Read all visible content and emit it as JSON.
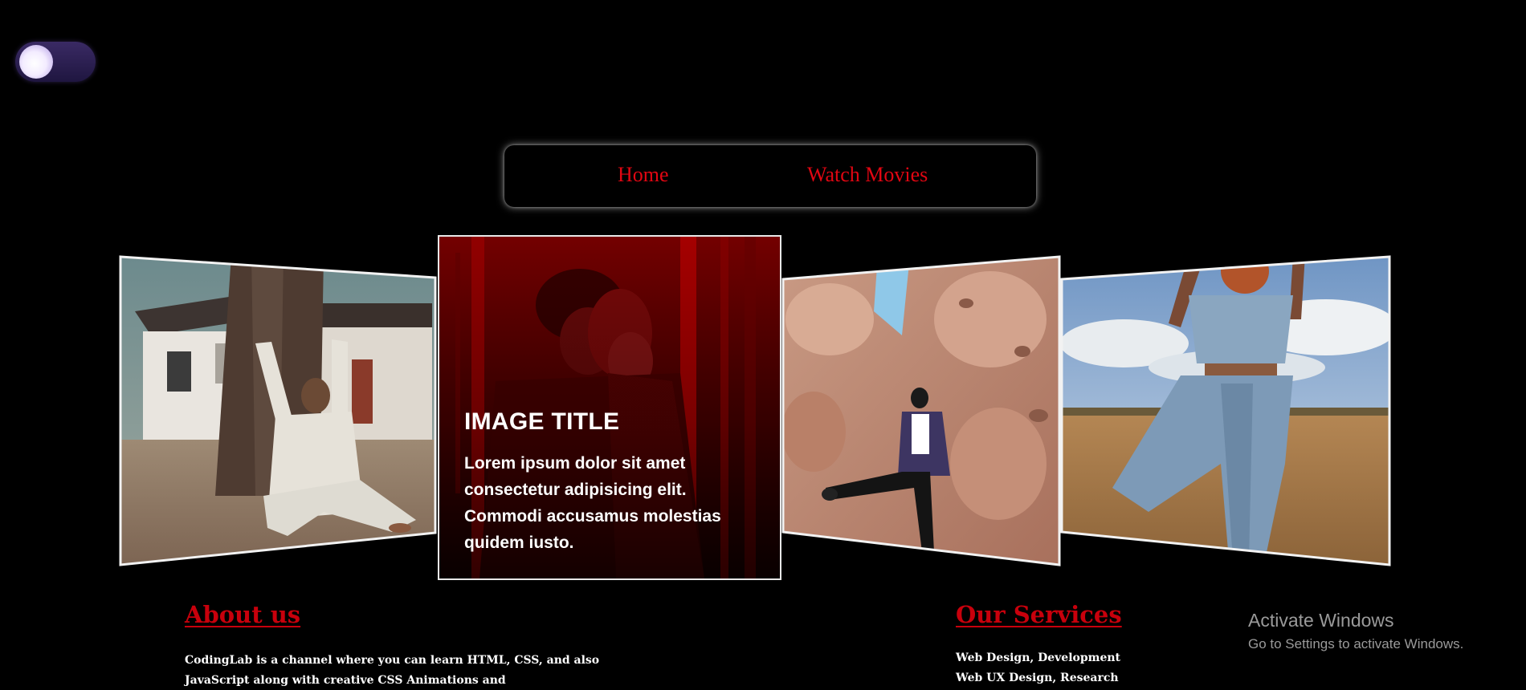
{
  "theme_toggle": {
    "icon": "moon-icon",
    "state": "dark"
  },
  "nav": {
    "items": [
      {
        "label": "Home"
      },
      {
        "label": "Watch Movies"
      }
    ],
    "link_color": "#e10612"
  },
  "gallery": {
    "active": {
      "title": "IMAGE TITLE",
      "description": "Lorem ipsum dolor sit amet consectetur adipisicing elit. Commodi accusamus molestias quidem iusto."
    },
    "panels": [
      {
        "subject": "man in white outfit sitting against a tree"
      },
      {
        "subject": "couple in a red-tinted forest"
      },
      {
        "subject": "woman in purple blazer kicking on a sandstone rock"
      },
      {
        "subject": "woman in denim outfit in a dry field"
      }
    ]
  },
  "about": {
    "title": "About us",
    "text": "CodingLab is a channel where you can learn HTML, CSS, and also JavaScript along with creative CSS Animations and"
  },
  "services": {
    "title": "Our Services",
    "items": [
      "Web Design, Development",
      "Web UX Design, Research"
    ]
  },
  "watermark": {
    "title": "Activate Windows",
    "subtitle": "Go to Settings to activate Windows."
  },
  "colors": {
    "background": "#000000",
    "accent_red": "#c8000c",
    "toggle": "#2b1f52"
  }
}
